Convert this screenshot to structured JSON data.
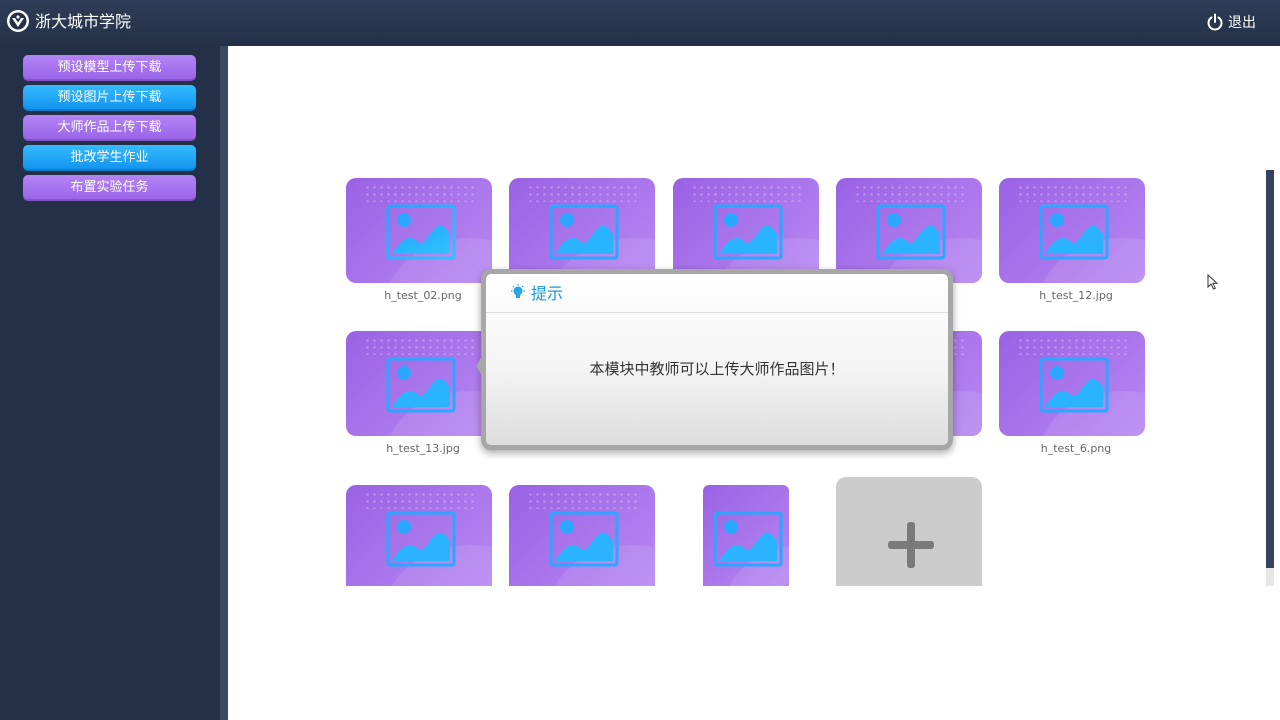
{
  "header": {
    "app_title": "浙大城市学院",
    "logout_label": "退出"
  },
  "sidebar": {
    "items": [
      {
        "label": "预设模型上传下载",
        "color": "purple"
      },
      {
        "label": "预设图片上传下载",
        "color": "blue"
      },
      {
        "label": "大师作品上传下载",
        "color": "purple"
      },
      {
        "label": "批改学生作业",
        "color": "blue"
      },
      {
        "label": "布置实验任务",
        "color": "purple"
      }
    ]
  },
  "gallery": {
    "row1": [
      "h_test_02.png",
      "",
      "",
      "",
      "h_test_12.jpg"
    ],
    "row2": [
      "h_test_13.jpg",
      "",
      "",
      "",
      "h_test_6.png"
    ],
    "row3_visible_tiles": 3,
    "add_icon": "plus-icon",
    "tile_icon": "image-placeholder-icon"
  },
  "dialog": {
    "title": "提示",
    "message": "本模块中教师可以上传大师作品图片！",
    "icon": "lightbulb-icon"
  },
  "colors": {
    "header_bg": "#2e3d57",
    "sidebar_bg": "#233048",
    "menu_purple": "#9862e8",
    "menu_blue": "#1092ee",
    "tile_purple": "#9a62e4",
    "dialog_title": "#1a9ae0"
  }
}
